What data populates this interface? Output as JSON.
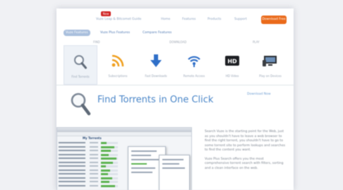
{
  "topnav": {
    "badge": "New",
    "links": [
      "Vuze Leap & Bitcomet Guide",
      "Home",
      "Features",
      "Products",
      "Support"
    ],
    "download_label": "Download Free"
  },
  "subnav": {
    "items": [
      "Vuze Features",
      "Vuze Plus Features",
      "Compare Features"
    ]
  },
  "groups": {
    "left": "FIND",
    "middle": "DOWNLOAD",
    "right": "PLAY"
  },
  "tools": [
    {
      "label": "Find Torrents",
      "icon": "magnifier-icon",
      "active": true
    },
    {
      "label": "Subscriptions",
      "icon": "rss-icon",
      "active": false
    },
    {
      "label": "Fast Downloads",
      "icon": "download-arrow-icon",
      "active": false
    },
    {
      "label": "Remote Access",
      "icon": "wifi-icon",
      "active": false
    },
    {
      "label": "HD Video",
      "icon": "hd-icon",
      "active": false
    },
    {
      "label": "Play on Devices",
      "icon": "devices-icon",
      "active": false
    }
  ],
  "hero": {
    "title": "Find Torrents in One Click",
    "link": "Download Now"
  },
  "app_screenshot": {
    "tab_label": "My Torrents",
    "progress": [
      0.35,
      0.8,
      0.6,
      0.45,
      0.9,
      0.7,
      0.3,
      0.55,
      0.4,
      0.65,
      0.5,
      0.85
    ]
  },
  "side_text": [
    "Search Vuze is the starting point for the Web, just as you shouldn't have to leave a web browser to find the right torrent, you shouldn't have to go to some torrent site to perform lookups and searches to find the content you want.",
    "Vuze Plus Search offers you the most comprehensive torrent search with filters, sorting and a clean interface on the web."
  ],
  "colors": {
    "accent": "#4a86c8",
    "download_button": "#ea6a1a",
    "badge": "#cf2323"
  }
}
